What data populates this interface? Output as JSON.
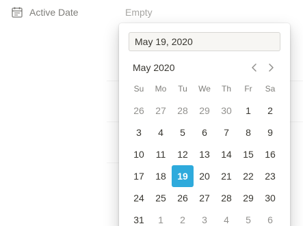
{
  "property": {
    "icon": "calendar-icon",
    "label": "Active Date",
    "value": "Empty"
  },
  "picker": {
    "input_value": "May 19, 2020",
    "month_label": "May 2020",
    "prev_icon": "chevron-left-icon",
    "next_icon": "chevron-right-icon",
    "accent_color": "#2eaadc",
    "weekdays": [
      "Su",
      "Mo",
      "Tu",
      "We",
      "Th",
      "Fr",
      "Sa"
    ],
    "days": [
      {
        "label": "26",
        "in_month": false
      },
      {
        "label": "27",
        "in_month": false
      },
      {
        "label": "28",
        "in_month": false
      },
      {
        "label": "29",
        "in_month": false
      },
      {
        "label": "30",
        "in_month": false
      },
      {
        "label": "1",
        "in_month": true
      },
      {
        "label": "2",
        "in_month": true
      },
      {
        "label": "3",
        "in_month": true
      },
      {
        "label": "4",
        "in_month": true
      },
      {
        "label": "5",
        "in_month": true
      },
      {
        "label": "6",
        "in_month": true
      },
      {
        "label": "7",
        "in_month": true
      },
      {
        "label": "8",
        "in_month": true
      },
      {
        "label": "9",
        "in_month": true
      },
      {
        "label": "10",
        "in_month": true
      },
      {
        "label": "11",
        "in_month": true
      },
      {
        "label": "12",
        "in_month": true
      },
      {
        "label": "13",
        "in_month": true
      },
      {
        "label": "14",
        "in_month": true
      },
      {
        "label": "15",
        "in_month": true
      },
      {
        "label": "16",
        "in_month": true
      },
      {
        "label": "17",
        "in_month": true
      },
      {
        "label": "18",
        "in_month": true
      },
      {
        "label": "19",
        "in_month": true,
        "selected": true
      },
      {
        "label": "20",
        "in_month": true
      },
      {
        "label": "21",
        "in_month": true
      },
      {
        "label": "22",
        "in_month": true
      },
      {
        "label": "23",
        "in_month": true
      },
      {
        "label": "24",
        "in_month": true
      },
      {
        "label": "25",
        "in_month": true
      },
      {
        "label": "26",
        "in_month": true
      },
      {
        "label": "27",
        "in_month": true
      },
      {
        "label": "28",
        "in_month": true
      },
      {
        "label": "29",
        "in_month": true
      },
      {
        "label": "30",
        "in_month": true
      },
      {
        "label": "31",
        "in_month": true
      },
      {
        "label": "1",
        "in_month": false
      },
      {
        "label": "2",
        "in_month": false
      },
      {
        "label": "3",
        "in_month": false
      },
      {
        "label": "4",
        "in_month": false
      },
      {
        "label": "5",
        "in_month": false
      },
      {
        "label": "6",
        "in_month": false
      }
    ]
  }
}
